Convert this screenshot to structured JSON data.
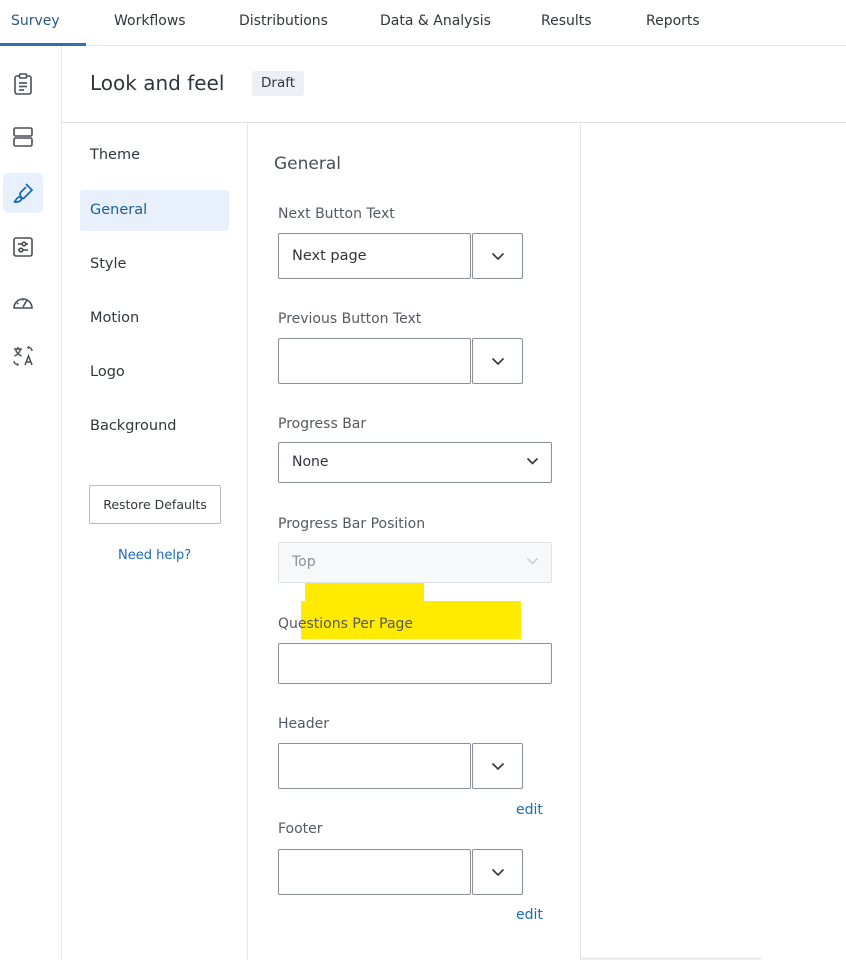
{
  "top_nav": {
    "tabs": [
      {
        "label": "Survey",
        "active": true
      },
      {
        "label": "Workflows"
      },
      {
        "label": "Distributions"
      },
      {
        "label": "Data & Analysis"
      },
      {
        "label": "Results"
      },
      {
        "label": "Reports"
      }
    ]
  },
  "left_rail": {
    "icons": [
      {
        "name": "survey-clipboard-icon"
      },
      {
        "name": "survey-flow-icon"
      },
      {
        "name": "look-and-feel-brush-icon",
        "active": true
      },
      {
        "name": "survey-options-icon"
      },
      {
        "name": "tools-gauge-icon"
      },
      {
        "name": "translate-icon"
      }
    ]
  },
  "header": {
    "title": "Look and feel",
    "badge": "Draft"
  },
  "sub_nav": {
    "items": [
      {
        "label": "Theme"
      },
      {
        "label": "General",
        "active": true
      },
      {
        "label": "Style"
      },
      {
        "label": "Motion"
      },
      {
        "label": "Logo"
      },
      {
        "label": "Background"
      }
    ],
    "restore_label": "Restore Defaults",
    "help_label": "Need help?"
  },
  "general": {
    "title": "General",
    "next_button": {
      "label": "Next Button Text",
      "value": "Next page"
    },
    "previous_button": {
      "label": "Previous Button Text",
      "value": ""
    },
    "progress_bar": {
      "label": "Progress Bar",
      "value": "None"
    },
    "progress_bar_position": {
      "label": "Progress Bar Position",
      "value": "Top",
      "disabled": true
    },
    "questions_per_page": {
      "label": "Questions Per Page",
      "value": ""
    },
    "header": {
      "label": "Header",
      "value": "",
      "edit_label": "edit"
    },
    "footer": {
      "label": "Footer",
      "value": "",
      "edit_label": "edit"
    }
  },
  "colors": {
    "accent": "#1b69b7",
    "active_bg": "#e7f0fb",
    "highlight": "#ffea00"
  }
}
